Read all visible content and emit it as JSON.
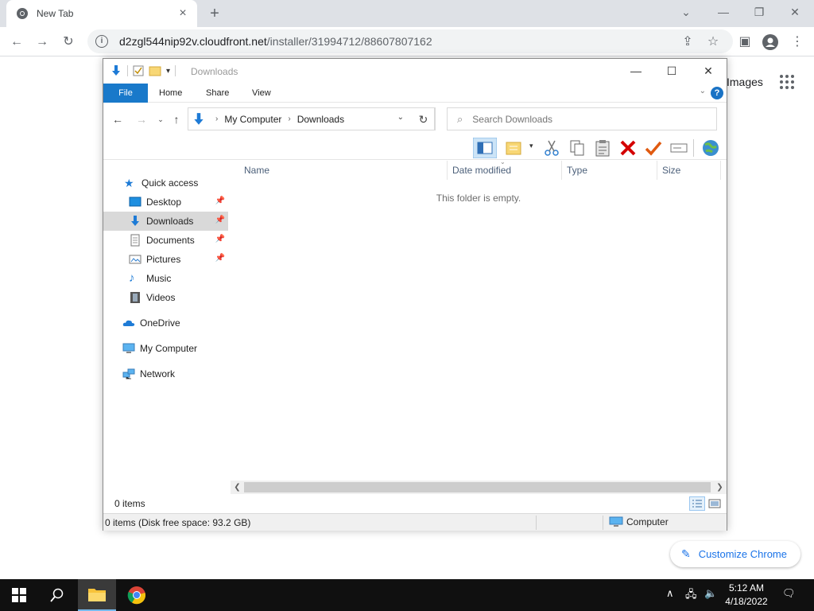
{
  "browser": {
    "tab_title": "New Tab",
    "url_host": "d2zgl544nip92v.cloudfront.net",
    "url_path": "/installer/31994712/88607807162",
    "ntp_images_link": "Images",
    "customize_label": "Customize Chrome"
  },
  "explorer": {
    "window_title": "Downloads",
    "ribbon_tabs": {
      "file": "File",
      "home": "Home",
      "share": "Share",
      "view": "View"
    },
    "address": {
      "root": "My Computer",
      "current": "Downloads"
    },
    "search_placeholder": "Search Downloads",
    "sidebar": {
      "quick_access": "Quick access",
      "desktop": "Desktop",
      "downloads": "Downloads",
      "documents": "Documents",
      "pictures": "Pictures",
      "music": "Music",
      "videos": "Videos",
      "onedrive": "OneDrive",
      "my_computer": "My Computer",
      "network": "Network"
    },
    "columns": {
      "name": "Name",
      "date_modified": "Date modified",
      "type": "Type",
      "size": "Size"
    },
    "empty_message": "This folder is empty.",
    "item_count": "0 items",
    "status_text": "0 items (Disk free space: 93.2 GB)",
    "status_zone": "Computer"
  },
  "taskbar": {
    "time": "5:12 AM",
    "date": "4/18/2022"
  }
}
